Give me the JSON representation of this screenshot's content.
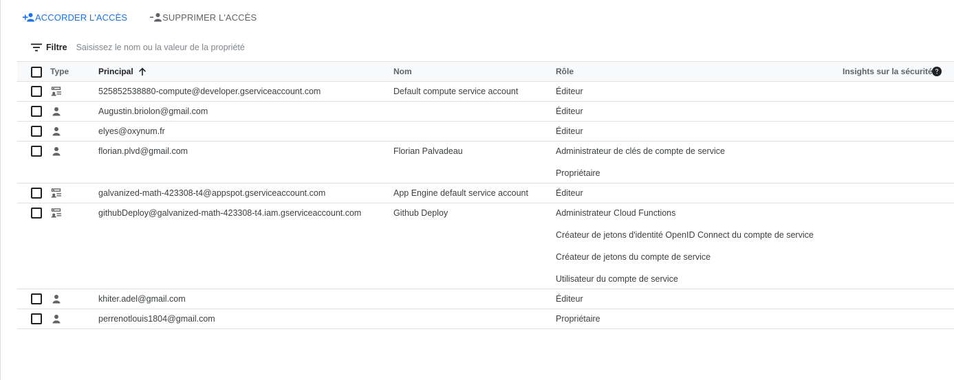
{
  "toolbar": {
    "grant_label": "ACCORDER L'ACCÈS",
    "remove_label": "SUPPRIMER L'ACCÈS"
  },
  "filter": {
    "label": "Filtre",
    "placeholder": "Saisissez le nom ou la valeur de la propriété"
  },
  "columns": {
    "type": "Type",
    "principal": "Principal",
    "nom": "Nom",
    "role": "Rôle",
    "insights": "Insights sur la sécurité"
  },
  "rows": [
    {
      "type_icon": "service-account-icon",
      "principal": "525852538880-compute@developer.gserviceaccount.com",
      "nom": "Default compute service account",
      "roles": [
        "Éditeur"
      ]
    },
    {
      "type_icon": "person-icon",
      "principal": "Augustin.briolon@gmail.com",
      "nom": "",
      "roles": [
        "Éditeur"
      ]
    },
    {
      "type_icon": "person-icon",
      "principal": "elyes@oxynum.fr",
      "nom": "",
      "roles": [
        "Éditeur"
      ]
    },
    {
      "type_icon": "person-icon",
      "principal": "florian.plvd@gmail.com",
      "nom": "Florian Palvadeau",
      "roles": [
        "Administrateur de clés de compte de service",
        "Propriétaire"
      ]
    },
    {
      "type_icon": "service-account-icon",
      "principal": "galvanized-math-423308-t4@appspot.gserviceaccount.com",
      "nom": "App Engine default service account",
      "roles": [
        "Éditeur"
      ]
    },
    {
      "type_icon": "service-account-icon",
      "principal": "githubDeploy@galvanized-math-423308-t4.iam.gserviceaccount.com",
      "nom": "Github Deploy",
      "roles": [
        "Administrateur Cloud Functions",
        "Créateur de jetons d'identité OpenID Connect du compte de service",
        "Créateur de jetons du compte de service",
        "Utilisateur du compte de service"
      ]
    },
    {
      "type_icon": "person-icon",
      "principal": "khiter.adel@gmail.com",
      "nom": "",
      "roles": [
        "Éditeur"
      ]
    },
    {
      "type_icon": "person-icon",
      "principal": "perrenotlouis1804@gmail.com",
      "nom": "",
      "roles": [
        "Propriétaire"
      ]
    }
  ],
  "colors": {
    "accent": "#1a73e8",
    "text": "#3c4043",
    "muted": "#5f6368",
    "header_bg": "#f8f9fa",
    "border": "#e0e0e0"
  }
}
